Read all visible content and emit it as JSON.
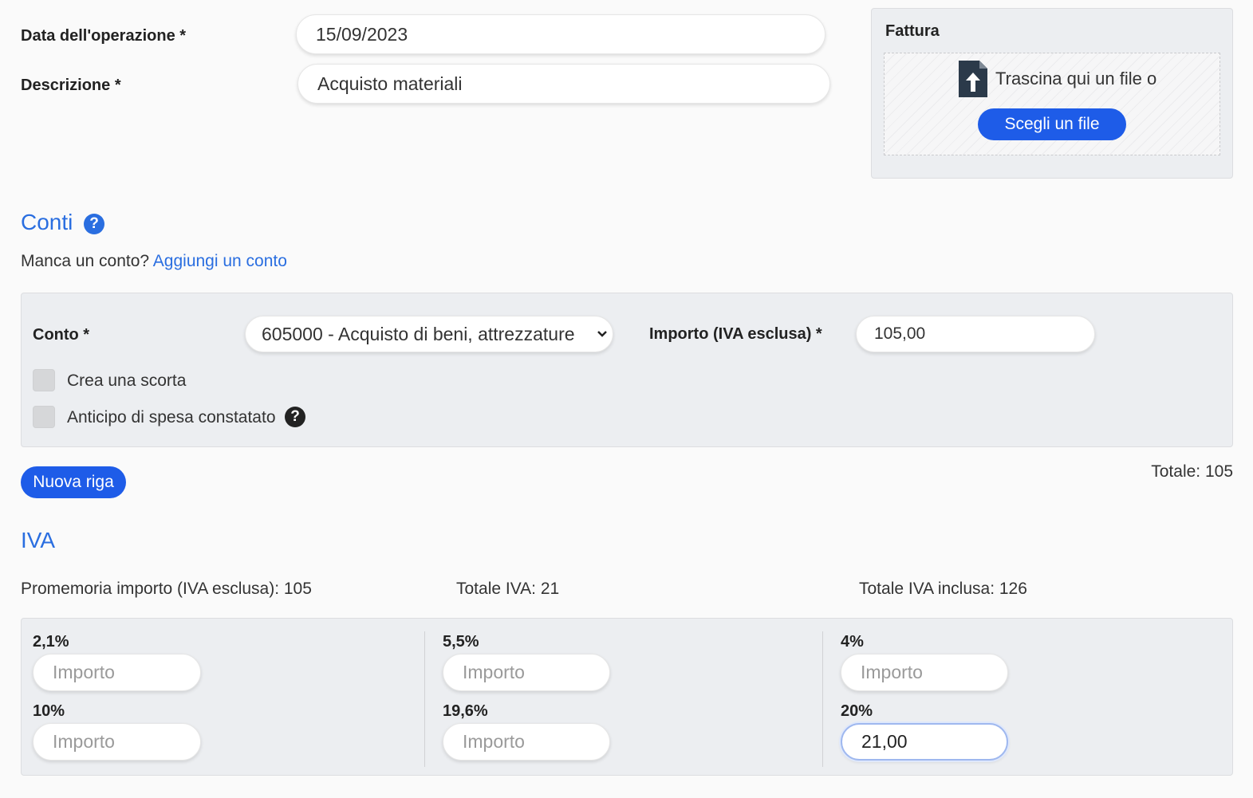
{
  "operation": {
    "date_label": "Data dell'operazione *",
    "date_value": "15/09/2023",
    "description_label": "Descrizione *",
    "description_value": "Acquisto materiali"
  },
  "invoice": {
    "title": "Fattura",
    "drop_text": "Trascina qui un file o",
    "choose_button": "Scegli un file"
  },
  "accounts": {
    "title": "Conti",
    "missing_text": "Manca un conto?",
    "add_link": "Aggiungi un conto",
    "account_label": "Conto *",
    "account_selected": "605000 - Acquisto di beni, attrezzature",
    "amount_label": "Importo (IVA esclusa) *",
    "amount_value": "105,00",
    "stock_label": "Crea una scorta",
    "advance_label": "Anticipo di spesa constatato",
    "new_row_button": "Nuova riga",
    "total": "Totale: 105"
  },
  "vat": {
    "title": "IVA",
    "reminder": "Promemoria importo (IVA esclusa): 105",
    "total_vat": "Totale IVA: 21",
    "total_incl": "Totale IVA inclusa: 126",
    "placeholder": "Importo",
    "rates": [
      {
        "label": "2,1%",
        "value": ""
      },
      {
        "label": "10%",
        "value": ""
      },
      {
        "label": "5,5%",
        "value": ""
      },
      {
        "label": "19,6%",
        "value": ""
      },
      {
        "label": "4%",
        "value": ""
      },
      {
        "label": "20%",
        "value": "21,00"
      }
    ]
  },
  "colors": {
    "accent": "#2a6ee0",
    "button": "#1e5ce8",
    "panel": "#eceef1",
    "icon_dark": "#2b3a4a"
  }
}
